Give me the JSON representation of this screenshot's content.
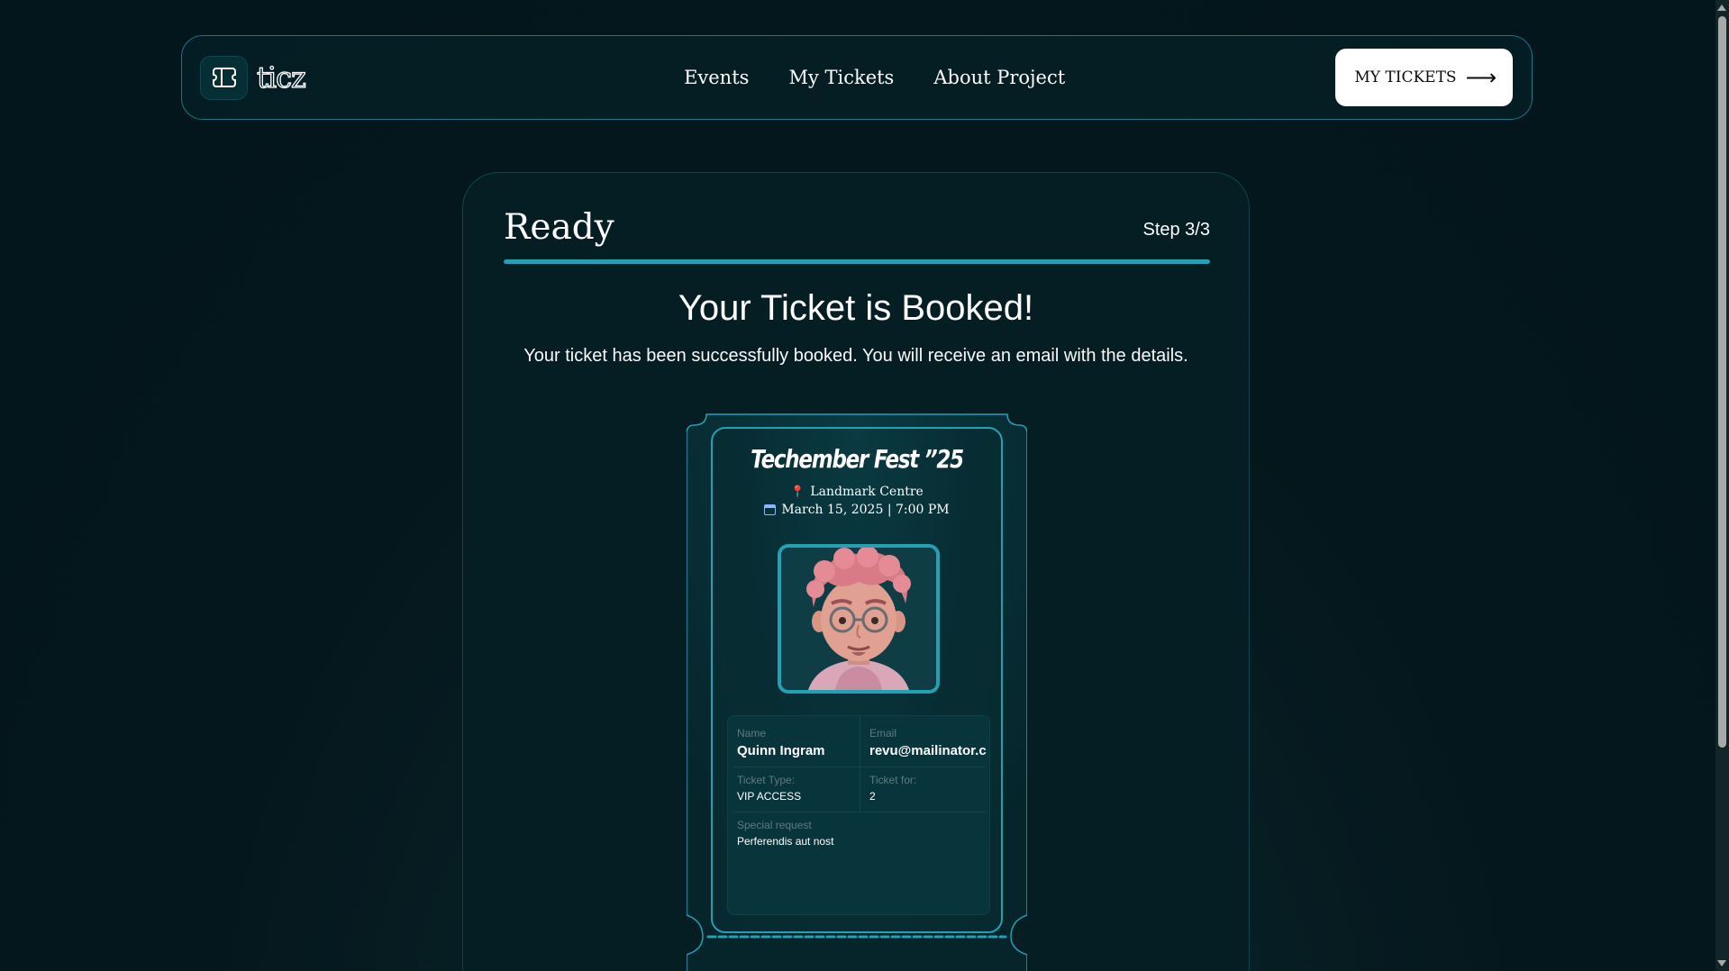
{
  "header": {
    "logo_text": "ticz",
    "nav": [
      {
        "label": "Events"
      },
      {
        "label": "My Tickets"
      },
      {
        "label": "About Project"
      }
    ],
    "cta_label": "MY TICKETS",
    "cta_arrow": "⟶"
  },
  "step": {
    "title": "Ready",
    "count": "Step 3/3",
    "progress": 1.0
  },
  "confirmation": {
    "title": "Your Ticket is Booked!",
    "subtitle": "Your ticket has been successfully booked. You will receive an email with the details."
  },
  "ticket": {
    "event_name": "Techember Fest ”25",
    "venue_icon": "map-pin-icon",
    "venue": "Landmark Centre",
    "date_icon": "calendar-icon",
    "date": "March 15, 2025 | 7:00 PM",
    "avatar": "user-avatar-cartoon",
    "fields": {
      "name_label": "Name",
      "name_value": "Quinn Ingram",
      "email_label": "Email",
      "email_value": "revu@mailinator.com",
      "type_label": "Ticket Type:",
      "type_value": "VIP ACCESS",
      "for_label": "Ticket for:",
      "for_value": "2",
      "request_label": "Special request",
      "request_value": "Perferendis aut nost"
    }
  },
  "colors": {
    "accent": "#24a0b5",
    "border": "#0e464f",
    "background": "#041e23",
    "cta_bg": "#ffffff"
  }
}
